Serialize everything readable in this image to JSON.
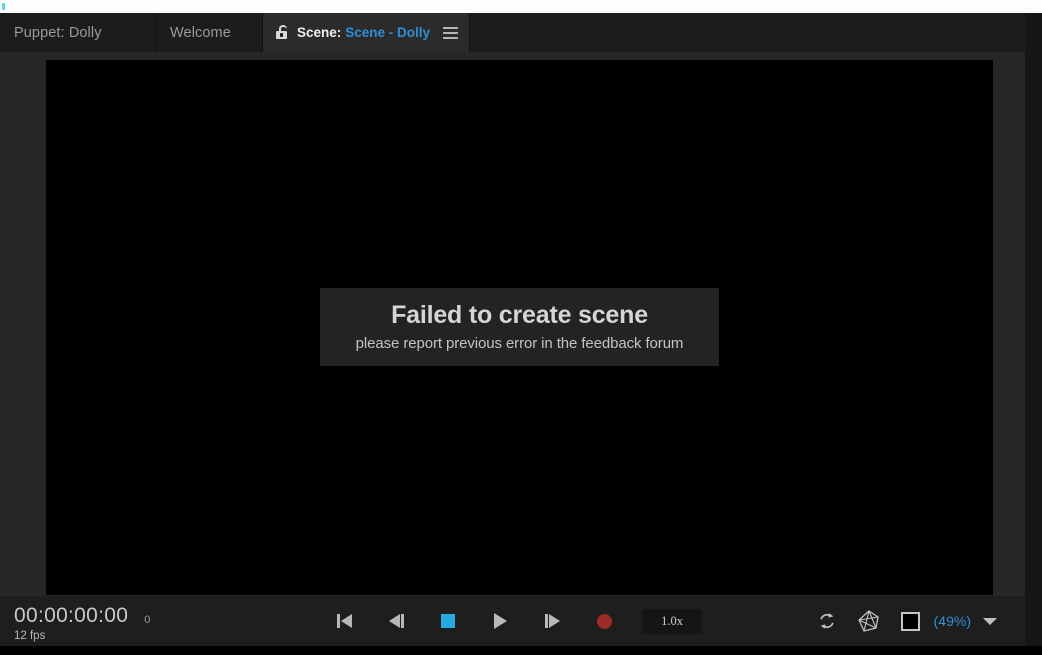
{
  "window": {
    "tabs": [
      {
        "label": "Puppet: Dolly",
        "active": false,
        "name": "tab-puppet-dolly"
      },
      {
        "label": "Welcome",
        "active": false,
        "name": "tab-welcome"
      },
      {
        "prefix": "Scene:",
        "name_text": "Scene - Dolly",
        "active": true,
        "lock_icon": "open-padlock-icon",
        "menu_icon": "hamburger-menu-icon",
        "name": "tab-scene-dolly"
      }
    ]
  },
  "viewport": {
    "error": {
      "title": "Failed to create scene",
      "subtitle": "please report previous error in the feedback forum"
    }
  },
  "transport_bar": {
    "timecode": "00:00:00:00",
    "frame_number": "0",
    "fps": "12 fps",
    "buttons": [
      {
        "label": "go-to-start",
        "icon": "skip-to-start-icon"
      },
      {
        "label": "step-back",
        "icon": "step-backward-icon"
      },
      {
        "label": "stop",
        "icon": "stop-square-icon"
      },
      {
        "label": "play",
        "icon": "play-triangle-icon"
      },
      {
        "label": "step-forward",
        "icon": "step-forward-icon"
      },
      {
        "label": "record",
        "icon": "record-circle-icon"
      }
    ],
    "speed": "1.0x",
    "right_controls": {
      "refresh_icon": "refresh-sync-icon",
      "gem_icon": "wireframe-polyhedron-icon",
      "frame_icon": "square-outline-icon",
      "zoom_level": "(49%)",
      "dropdown_icon": "caret-down-icon"
    }
  },
  "colors": {
    "accent_blue": "#2f8fd6",
    "stop_blue": "#27a9e1",
    "record_red": "#9e2a28",
    "panel_bg": "#272727",
    "bar_bg": "#1e1e1e",
    "tabbar_bg": "#1c1c1c"
  }
}
